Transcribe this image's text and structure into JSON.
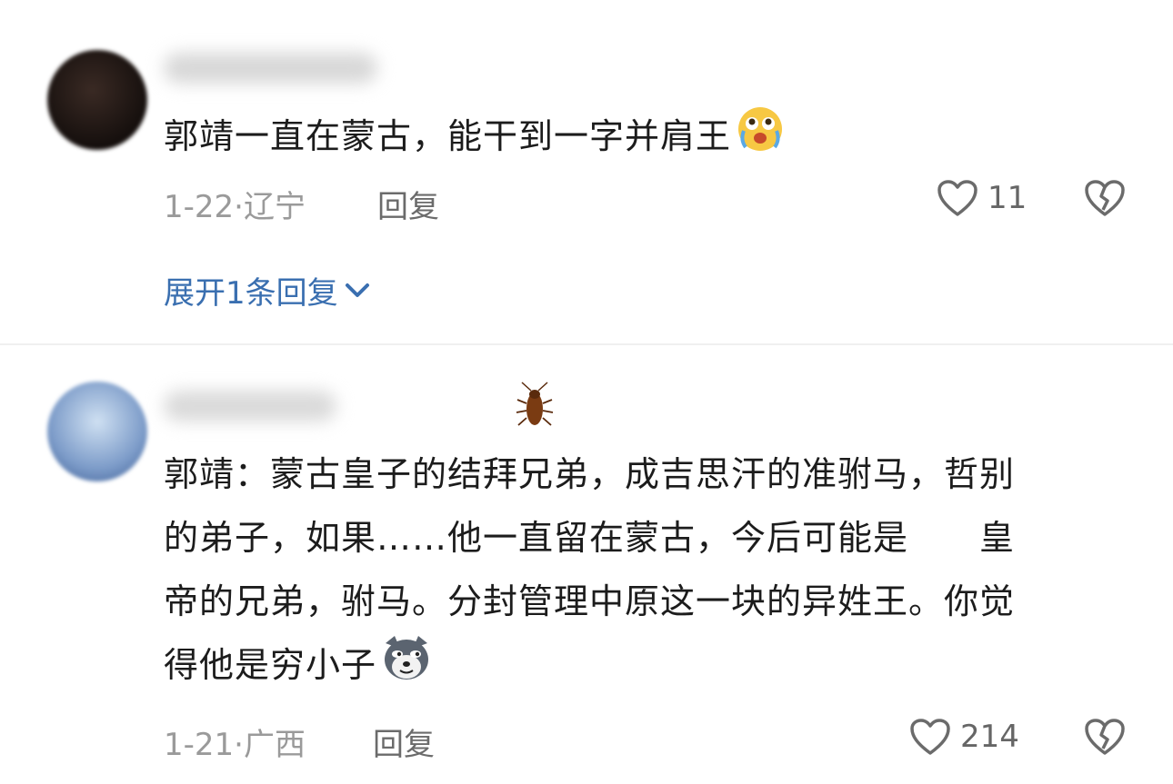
{
  "comments": [
    {
      "text": "郭靖一直在蒙古，能干到一字并肩王",
      "date": "1-22",
      "location": "辽宁",
      "reply_label": "回复",
      "likes": "11",
      "expand_label": "展开1条回复"
    },
    {
      "lines": [
        "郭靖：蒙古皇子的结拜兄弟，成吉思汗的准驸马，哲别",
        "的弟子，如果……他一直留在蒙古，今后可能是　　皇",
        "帝的兄弟，驸马。分封管理中原这一块的异姓王。你觉",
        "得他是穷小子"
      ],
      "date": "1-21",
      "location": "广西",
      "reply_label": "回复",
      "likes": "214"
    }
  ],
  "icons": {
    "like": "heart-outline-icon",
    "dislike": "broken-heart-icon",
    "expand": "chevron-down-icon",
    "emoji1": "crying-laughing-emoji",
    "emoji2": "doge-emoji",
    "sticker": "cockroach-sticker"
  },
  "colors": {
    "link": "#3a6fb0",
    "meta": "#9a9a9a",
    "text": "#1c1c1c"
  }
}
